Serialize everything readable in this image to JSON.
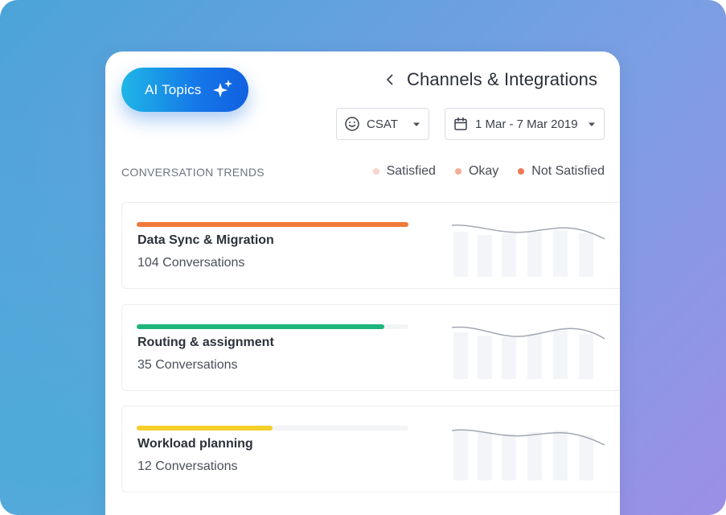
{
  "ai_button": {
    "label": "AI Topics",
    "icon": "sparkle-icon"
  },
  "header": {
    "back_icon": "chevron-left-icon",
    "title": "Channels & Integrations"
  },
  "filters": {
    "metric": {
      "icon": "smiley-icon",
      "value": "CSAT"
    },
    "date_range": {
      "icon": "calendar-icon",
      "value": "1 Mar - 7 Mar 2019"
    }
  },
  "section": {
    "label": "CONVERSATION TRENDS"
  },
  "legend": [
    {
      "label": "Satisfied",
      "color": "#f8d3cd"
    },
    {
      "label": "Okay",
      "color": "#f6ad98"
    },
    {
      "label": "Not Satisfied",
      "color": "#ef7a55"
    }
  ],
  "topics": [
    {
      "name": "Data Sync & Migration",
      "count": "104 Conversations",
      "progress": 1.0,
      "color": "#f07a3a"
    },
    {
      "name": "Routing & assignment",
      "count": "35 Conversations",
      "progress": 0.91,
      "color": "#1eb57d"
    },
    {
      "name": "Workload planning",
      "count": "12 Conversations",
      "progress": 0.5,
      "color": "#f5cf2a"
    }
  ],
  "colors": {
    "accent_blue": "#1577e8",
    "card_bg": "#ffffff",
    "sparkline": "#9aa0aa"
  }
}
